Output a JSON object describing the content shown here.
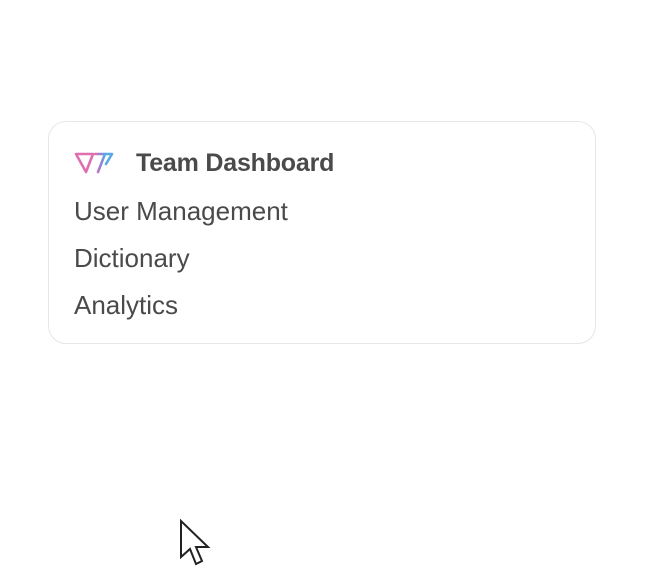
{
  "menu": {
    "logo_icon": "brand-logo-icon",
    "header_title": "Team Dashboard",
    "items": [
      {
        "label": "User Management"
      },
      {
        "label": "Dictionary"
      },
      {
        "label": "Analytics"
      }
    ]
  },
  "colors": {
    "text": "#4a4a4a",
    "border": "#e6e6e6",
    "logo_pink": "#e06fb0",
    "logo_purple": "#9b7fd4",
    "logo_blue": "#5aa9e6"
  },
  "cursor": {
    "icon": "mouse-pointer-icon"
  }
}
